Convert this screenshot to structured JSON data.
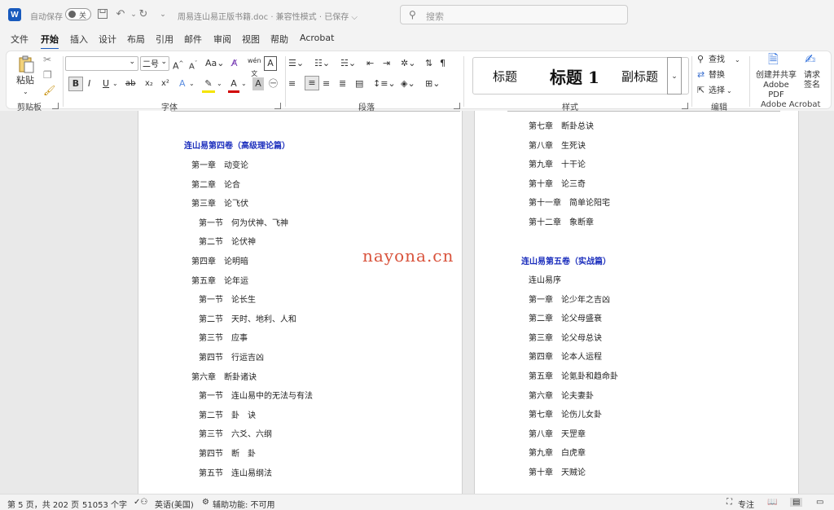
{
  "titlebar": {
    "app_logo": "W",
    "autosave_label": "自动保存",
    "autosave_toggle": "关",
    "icons": [
      "save-icon",
      "undo-icon",
      "redo-icon",
      "customize-icon"
    ],
    "doc_title": "周易连山易正版书籍.doc  ·  兼容性模式  ·  已保存  ⌵",
    "search_placeholder": "搜索"
  },
  "tabs": [
    "文件",
    "开始",
    "插入",
    "设计",
    "布局",
    "引用",
    "邮件",
    "审阅",
    "视图",
    "帮助",
    "Acrobat"
  ],
  "active_tab": "开始",
  "ribbon": {
    "clipboard": {
      "paste_label": "粘贴",
      "group_label": "剪贴板"
    },
    "font": {
      "font_name": "",
      "font_size": "二号",
      "group_label": "字体",
      "buttons": [
        "B",
        "I",
        "U",
        "ab",
        "x₂",
        "x²",
        "A",
        "A",
        "A"
      ]
    },
    "paragraph": {
      "group_label": "段落"
    },
    "styles": {
      "items": [
        "标题",
        "标题 1",
        "副标题"
      ],
      "group_label": "样式"
    },
    "editing": {
      "find": "查找",
      "replace": "替换",
      "select": "选择",
      "group_label": "编辑"
    },
    "acrobat": {
      "create_share": "创建并共享\nAdobe PDF",
      "create_share_line1": "创建并共享",
      "create_share_line2": "Adobe PDF",
      "request_sign_line1": "请求",
      "request_sign_line2": "签名",
      "group_label": "Adobe Acrobat"
    }
  },
  "left_page": {
    "heading": "连山易第四卷（高级理论篇）",
    "lines": [
      {
        "text": "第一章　动变论",
        "indent": 0
      },
      {
        "text": "第二章　论合",
        "indent": 0
      },
      {
        "text": "第三章　论飞伏",
        "indent": 0
      },
      {
        "text": "第一节　何为伏神、飞神",
        "indent": 1
      },
      {
        "text": "第二节　论伏神",
        "indent": 1
      },
      {
        "text": "第四章　论明暗",
        "indent": 0
      },
      {
        "text": "第五章　论年运",
        "indent": 0
      },
      {
        "text": "第一节　论长生",
        "indent": 1
      },
      {
        "text": "第二节　天时、地利、人和",
        "indent": 1
      },
      {
        "text": "第三节　应事",
        "indent": 1
      },
      {
        "text": "第四节　行运吉凶",
        "indent": 1
      },
      {
        "text": "第六章　断卦诸诀",
        "indent": 0
      },
      {
        "text": "第一节　连山易中的无法与有法",
        "indent": 1
      },
      {
        "text": "第二节　卦　诀",
        "indent": 1
      },
      {
        "text": "第三节　六爻、六纲",
        "indent": 1
      },
      {
        "text": "第四节　断　卦",
        "indent": 1
      },
      {
        "text": "第五节　连山易纲法",
        "indent": 1
      }
    ]
  },
  "right_page": {
    "lines_top": [
      "第七章　断卦总诀",
      "第八章　生死诀",
      "第九章　十干论",
      "第十章　论三奇",
      "第十一章　简单论阳宅",
      "第十二章　象断章"
    ],
    "heading": "连山易第五卷（实战篇）",
    "lines_bottom": [
      "连山易序",
      "第一章　论少年之吉凶",
      "第二章　论父母盛衰",
      "第三章　论父母总诀",
      "第四章　论本人运程",
      "第五章　论氪卦和趋命卦",
      "第六章　论夫妻卦",
      "第七章　论伤儿女卦",
      "第八章　天罡章",
      "第九章　白虎章",
      "第十章　天贼论"
    ]
  },
  "watermark": "nayona.cn",
  "statusbar": {
    "page": "第 5 页，共 202 页",
    "words": "51053 个字",
    "language": "英语(美国)",
    "accessibility": "辅助功能: 不可用",
    "focus": "专注"
  },
  "colors": {
    "accent": "#185abd",
    "heading_blue": "#1c2fbd",
    "watermark": "#d9533c"
  }
}
